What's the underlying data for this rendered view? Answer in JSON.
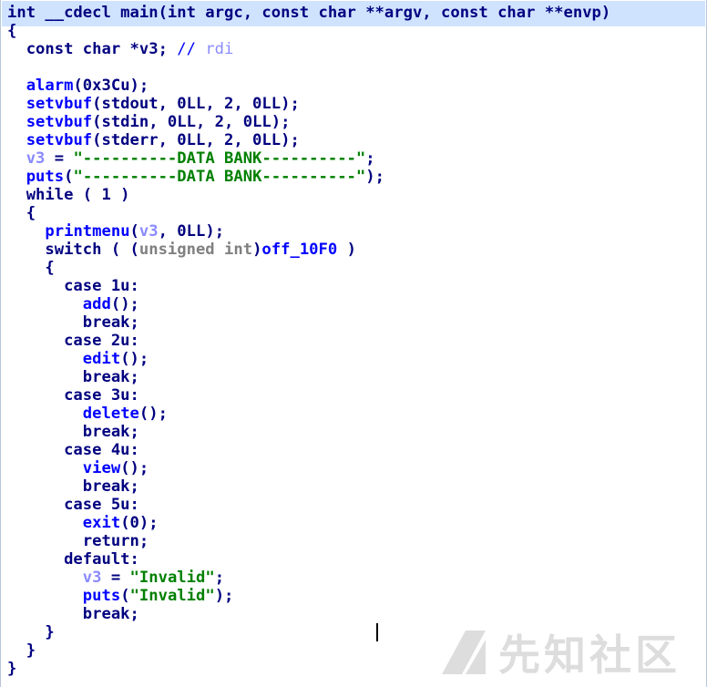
{
  "code": {
    "lines": [
      [
        {
          "t": "int __cdecl main(int argc, const char **argv, const char **envp)",
          "c": "default"
        }
      ],
      [
        {
          "t": "{",
          "c": "default"
        }
      ],
      [
        {
          "t": "  const char *v3; ",
          "c": "default"
        },
        {
          "t": "// ",
          "c": "comment"
        },
        {
          "t": "rdi",
          "c": "comment-var"
        }
      ],
      [
        {
          "t": "",
          "c": "default"
        }
      ],
      [
        {
          "t": "  ",
          "c": "default"
        },
        {
          "t": "alarm",
          "c": "blue"
        },
        {
          "t": "(0x3Cu);",
          "c": "default"
        }
      ],
      [
        {
          "t": "  ",
          "c": "default"
        },
        {
          "t": "setvbuf",
          "c": "blue"
        },
        {
          "t": "(stdout, 0LL, 2, 0LL);",
          "c": "default"
        }
      ],
      [
        {
          "t": "  ",
          "c": "default"
        },
        {
          "t": "setvbuf",
          "c": "blue"
        },
        {
          "t": "(stdin, 0LL, 2, 0LL);",
          "c": "default"
        }
      ],
      [
        {
          "t": "  ",
          "c": "default"
        },
        {
          "t": "setvbuf",
          "c": "blue"
        },
        {
          "t": "(stderr, 0LL, 2, 0LL);",
          "c": "default"
        }
      ],
      [
        {
          "t": "  ",
          "c": "default"
        },
        {
          "t": "v3",
          "c": "var"
        },
        {
          "t": " = ",
          "c": "default"
        },
        {
          "t": "\"----------DATA BANK----------\"",
          "c": "string"
        },
        {
          "t": ";",
          "c": "default"
        }
      ],
      [
        {
          "t": "  ",
          "c": "default"
        },
        {
          "t": "puts",
          "c": "blue"
        },
        {
          "t": "(",
          "c": "default"
        },
        {
          "t": "\"----------DATA BANK----------\"",
          "c": "string"
        },
        {
          "t": ");",
          "c": "default"
        }
      ],
      [
        {
          "t": "  while ( 1 )",
          "c": "default"
        }
      ],
      [
        {
          "t": "  {",
          "c": "default"
        }
      ],
      [
        {
          "t": "    ",
          "c": "default"
        },
        {
          "t": "printmenu",
          "c": "blue"
        },
        {
          "t": "(",
          "c": "default"
        },
        {
          "t": "v3",
          "c": "var"
        },
        {
          "t": ", 0LL);",
          "c": "default"
        }
      ],
      [
        {
          "t": "    switch ( (",
          "c": "default"
        },
        {
          "t": "unsigned int",
          "c": "grey"
        },
        {
          "t": ")",
          "c": "default"
        },
        {
          "t": "off_10F0",
          "c": "blue"
        },
        {
          "t": " )",
          "c": "default"
        }
      ],
      [
        {
          "t": "    {",
          "c": "default"
        }
      ],
      [
        {
          "t": "      case 1u:",
          "c": "default"
        }
      ],
      [
        {
          "t": "        ",
          "c": "default"
        },
        {
          "t": "add",
          "c": "blue"
        },
        {
          "t": "();",
          "c": "default"
        }
      ],
      [
        {
          "t": "        break;",
          "c": "default"
        }
      ],
      [
        {
          "t": "      case 2u:",
          "c": "default"
        }
      ],
      [
        {
          "t": "        ",
          "c": "default"
        },
        {
          "t": "edit",
          "c": "blue"
        },
        {
          "t": "();",
          "c": "default"
        }
      ],
      [
        {
          "t": "        break;",
          "c": "default"
        }
      ],
      [
        {
          "t": "      case 3u:",
          "c": "default"
        }
      ],
      [
        {
          "t": "        ",
          "c": "default"
        },
        {
          "t": "delete",
          "c": "blue"
        },
        {
          "t": "();",
          "c": "default"
        }
      ],
      [
        {
          "t": "        break;",
          "c": "default"
        }
      ],
      [
        {
          "t": "      case 4u:",
          "c": "default"
        }
      ],
      [
        {
          "t": "        ",
          "c": "default"
        },
        {
          "t": "view",
          "c": "blue"
        },
        {
          "t": "();",
          "c": "default"
        }
      ],
      [
        {
          "t": "        break;",
          "c": "default"
        }
      ],
      [
        {
          "t": "      case 5u:",
          "c": "default"
        }
      ],
      [
        {
          "t": "        ",
          "c": "default"
        },
        {
          "t": "exit",
          "c": "blue"
        },
        {
          "t": "(0);",
          "c": "default"
        }
      ],
      [
        {
          "t": "        return;",
          "c": "default"
        }
      ],
      [
        {
          "t": "      default:",
          "c": "default"
        }
      ],
      [
        {
          "t": "        ",
          "c": "default"
        },
        {
          "t": "v3",
          "c": "var"
        },
        {
          "t": " = ",
          "c": "default"
        },
        {
          "t": "\"Invalid\"",
          "c": "string"
        },
        {
          "t": ";",
          "c": "default"
        }
      ],
      [
        {
          "t": "        ",
          "c": "default"
        },
        {
          "t": "puts",
          "c": "blue"
        },
        {
          "t": "(",
          "c": "default"
        },
        {
          "t": "\"Invalid\"",
          "c": "string"
        },
        {
          "t": ");",
          "c": "default"
        }
      ],
      [
        {
          "t": "        break;",
          "c": "default"
        }
      ],
      [
        {
          "t": "    }",
          "c": "default"
        }
      ],
      [
        {
          "t": "  }",
          "c": "default"
        }
      ],
      [
        {
          "t": "}",
          "c": "default"
        }
      ]
    ]
  },
  "watermark": {
    "text": "先知社区",
    "icon": "xianzhi-logo-icon"
  }
}
